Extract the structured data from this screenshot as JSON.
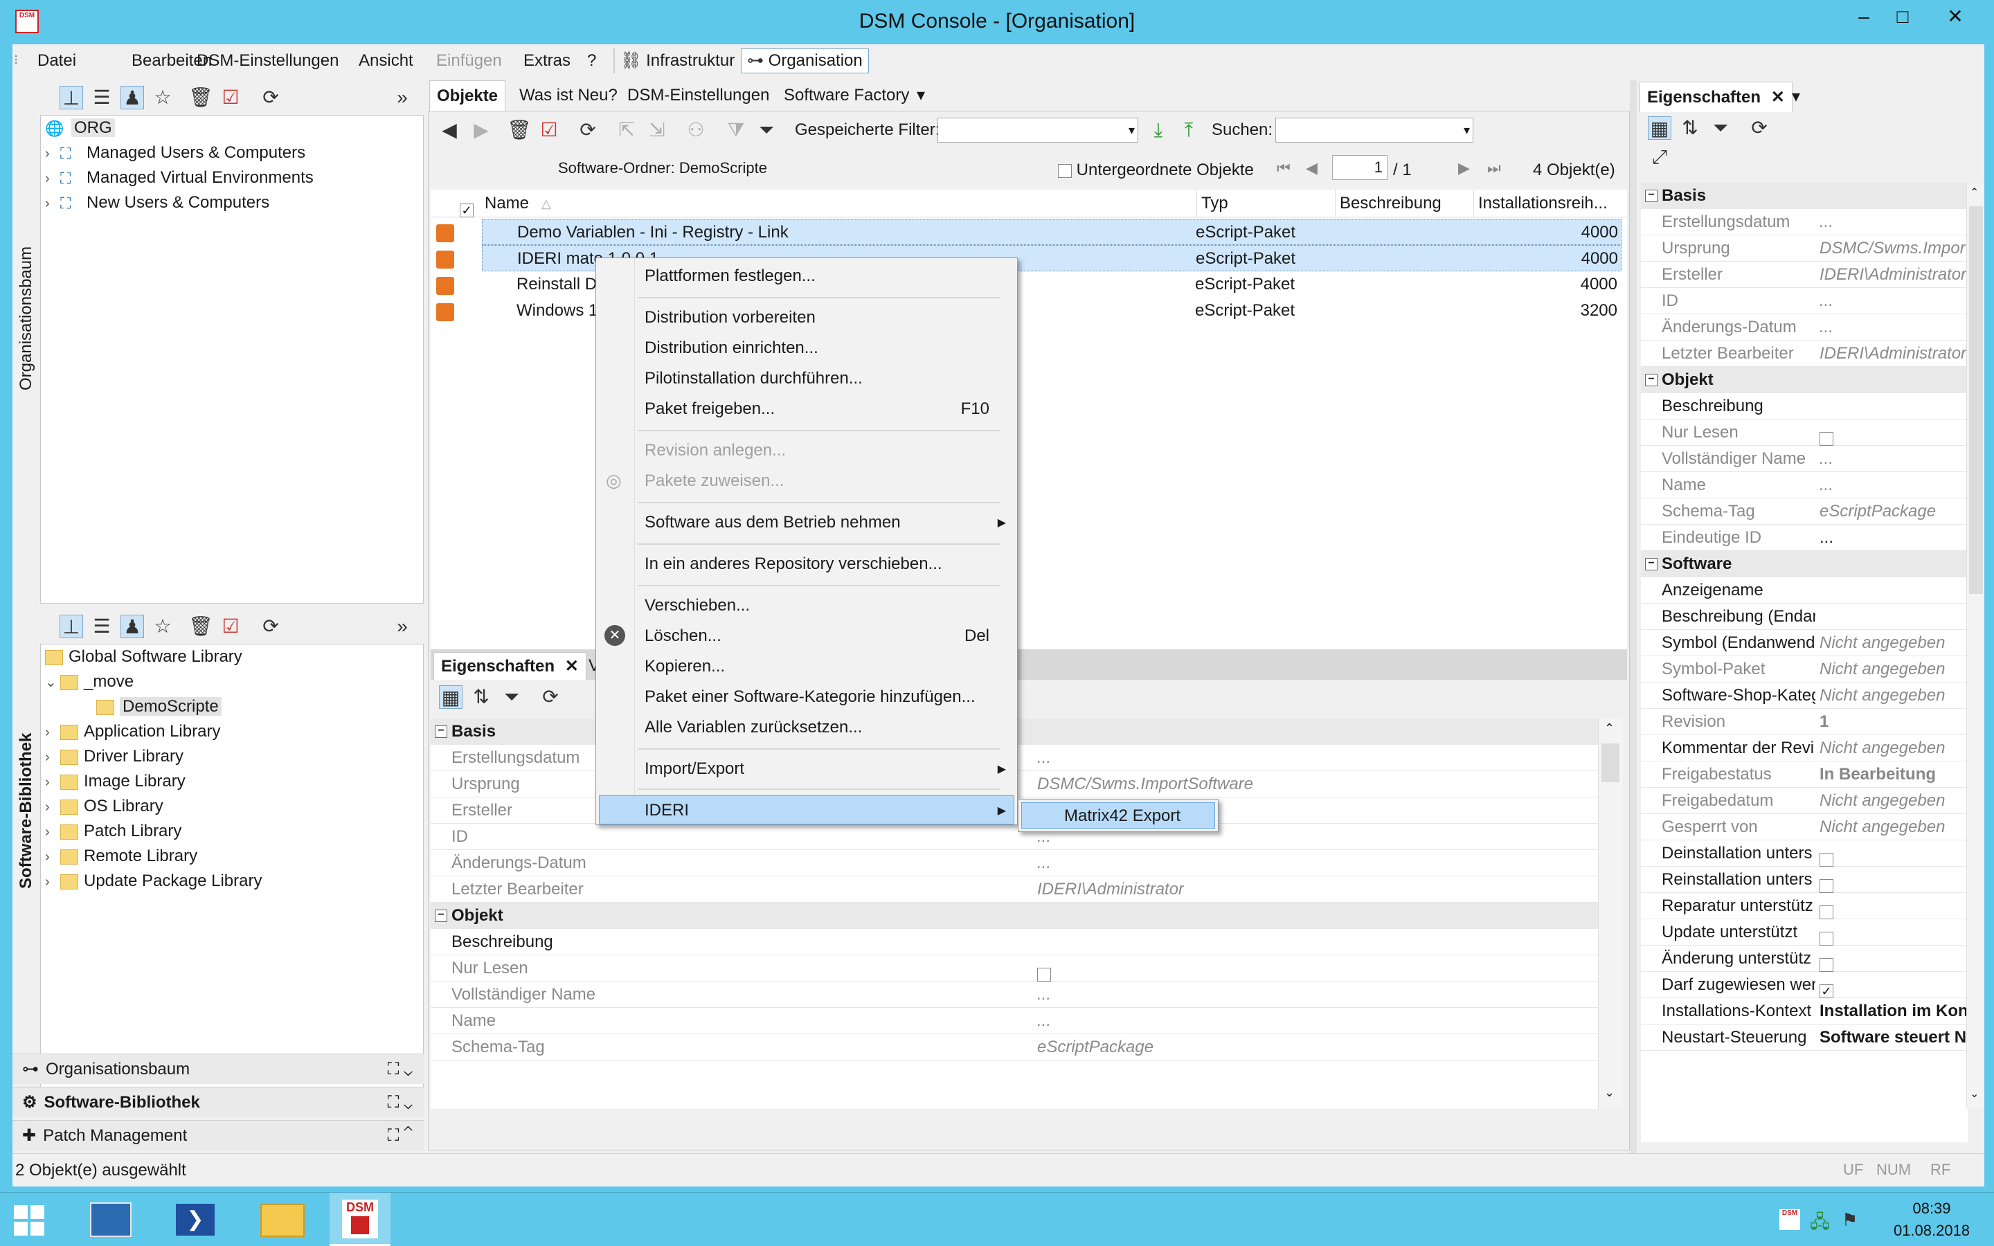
{
  "window": {
    "title": "DSM Console - [Organisation]",
    "app_icon_text": "DSM",
    "minimize": "–",
    "maximize": "□",
    "close": "✕"
  },
  "menu": {
    "items": [
      "Datei",
      "Bearbeiten",
      "DSM-Einstellungen",
      "Ansicht",
      "Einfügen",
      "Extras",
      "?"
    ],
    "infrastruktur": "Infrastruktur",
    "organisation": "Organisation"
  },
  "org_tree": {
    "root": "ORG",
    "items": [
      "Managed Users & Computers",
      "Managed Virtual Environments",
      "New Users & Computers"
    ],
    "side_tab": "Organisationsbaum"
  },
  "sw_tree": {
    "side_tab": "Software-Bibliothek",
    "root": "Global Software Library",
    "move": "_move",
    "selected": "DemoScripte",
    "items": [
      "Application Library",
      "Driver Library",
      "Image Library",
      "OS Library",
      "Patch Library",
      "Remote Library",
      "Update Package Library"
    ]
  },
  "accordion": {
    "org": "Organisationsbaum",
    "sw": "Software-Bibliothek",
    "patch": "Patch Management"
  },
  "status": {
    "left": "2 Objekt(e) ausgewählt",
    "uf": "UF",
    "num": "NUM",
    "rf": "RF"
  },
  "main_tabs": [
    "Objekte",
    "Was ist Neu?",
    "DSM-Einstellungen",
    "Software Factory"
  ],
  "toolbar": {
    "saved_filter_label": "Gespeicherte Filter:",
    "search_label": "Suchen:"
  },
  "folder_line": {
    "label": "Software-Ordner: DemoScripte",
    "sub_objects": "Untergeordnete Objekte",
    "page": "1",
    "page_total": "/ 1",
    "count": "4 Objekt(e)"
  },
  "grid": {
    "columns": [
      "Name",
      "Typ",
      "Beschreibung",
      "Installationsreih..."
    ],
    "rows": [
      {
        "name": "Demo Variablen - Ini - Registry - Link",
        "type": "eScript-Paket",
        "order": "4000"
      },
      {
        "name": "IDERI mate 1.0.0.1",
        "type": "eScript-Paket",
        "order": "4000"
      },
      {
        "name": "Reinstall Dem",
        "type": "eScript-Paket",
        "order": "4000"
      },
      {
        "name": "Windows 10 1",
        "type": "eScript-Paket",
        "order": "3200"
      }
    ]
  },
  "context_menu": {
    "items": [
      "Plattformen festlegen...",
      "Distribution vorbereiten",
      "Distribution einrichten...",
      "Pilotinstallation durchführen...",
      "Paket freigeben...",
      "Revision anlegen...",
      "Pakete zuweisen...",
      "Software aus dem Betrieb nehmen",
      "In ein anderes Repository verschieben...",
      "Verschieben...",
      "Löschen...",
      "Kopieren...",
      "Paket einer Software-Kategorie hinzufügen...",
      "Alle Variablen zurücksetzen...",
      "Import/Export",
      "IDERI"
    ],
    "shortcut_release": "F10",
    "shortcut_delete": "Del",
    "submenu_item": "Matrix42 Export"
  },
  "bottom_props": {
    "tab_active": "Eigenschaften",
    "tab_other": "Va",
    "sections": {
      "basis": "Basis",
      "objekt": "Objekt"
    },
    "basis_rows": [
      {
        "name": "Erstellungsdatum",
        "value": "..."
      },
      {
        "name": "Ursprung",
        "value": "DSMC/Swms.ImportSoftware"
      },
      {
        "name": "Ersteller",
        "value": ""
      },
      {
        "name": "ID",
        "value": "..."
      },
      {
        "name": "Änderungs-Datum",
        "value": "..."
      },
      {
        "name": "Letzter Bearbeiter",
        "value": "IDERI\\Administrator"
      }
    ],
    "objekt_rows": [
      {
        "name": "Beschreibung",
        "value": ""
      },
      {
        "name": "Nur Lesen",
        "value": ""
      },
      {
        "name": "Vollständiger Name",
        "value": "..."
      },
      {
        "name": "Name",
        "value": "..."
      },
      {
        "name": "Schema-Tag",
        "value": "eScriptPackage"
      }
    ]
  },
  "right_props": {
    "tab": "Eigenschaften",
    "sections": {
      "basis": "Basis",
      "objekt": "Objekt",
      "software": "Software"
    },
    "basis_rows": [
      {
        "name": "Erstellungsdatum",
        "value": "..."
      },
      {
        "name": "Ursprung",
        "value": "DSMC/Swms.Impor"
      },
      {
        "name": "Ersteller",
        "value": "IDERI\\Administrator"
      },
      {
        "name": "ID",
        "value": "..."
      },
      {
        "name": "Änderungs-Datum",
        "value": "..."
      },
      {
        "name": "Letzter Bearbeiter",
        "value": "IDERI\\Administrator"
      }
    ],
    "objekt_rows": [
      {
        "name": "Beschreibung",
        "value": ""
      },
      {
        "name": "Nur Lesen",
        "value": ""
      },
      {
        "name": "Vollständiger Name",
        "value": "..."
      },
      {
        "name": "Name",
        "value": "..."
      },
      {
        "name": "Schema-Tag",
        "value": "eScriptPackage"
      },
      {
        "name": "Eindeutige ID",
        "value": "..."
      }
    ],
    "software_rows": [
      {
        "name": "Anzeigename",
        "value": ""
      },
      {
        "name": "Beschreibung (Endan",
        "value": ""
      },
      {
        "name": "Symbol (Endanwend",
        "value": "Nicht angegeben"
      },
      {
        "name": "Symbol-Paket",
        "value": "Nicht angegeben"
      },
      {
        "name": "Software-Shop-Kateg",
        "value": "Nicht angegeben"
      },
      {
        "name": "Revision",
        "value": "1"
      },
      {
        "name": "Kommentar der Revi",
        "value": "Nicht angegeben"
      },
      {
        "name": "Freigabestatus",
        "value": "In Bearbeitung"
      },
      {
        "name": "Freigabedatum",
        "value": "Nicht angegeben"
      },
      {
        "name": "Gesperrt von",
        "value": "Nicht angegeben"
      },
      {
        "name": "Deinstallation unters",
        "value": ""
      },
      {
        "name": "Reinstallation unters",
        "value": ""
      },
      {
        "name": "Reparatur unterstütz",
        "value": ""
      },
      {
        "name": "Update unterstützt",
        "value": ""
      },
      {
        "name": "Änderung unterstütz",
        "value": ""
      },
      {
        "name": "Darf zugewiesen wer",
        "value": ""
      },
      {
        "name": "Installations-Kontext",
        "value": "Installation im Kon"
      },
      {
        "name": "Neustart-Steuerung",
        "value": "Software steuert N"
      }
    ]
  },
  "taskbar": {
    "time": "08:39",
    "date": "01.08.2018",
    "dsm_label": "DSM"
  },
  "colors": {
    "titlebar": "#5ec8ea",
    "selection": "#cfe6fb",
    "menu_highlight": "#b8dbfa",
    "package_icon": "#e87522"
  }
}
